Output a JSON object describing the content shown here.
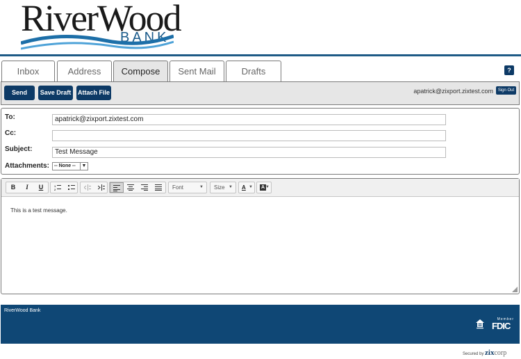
{
  "brand": {
    "logo_name": "RiverWood",
    "logo_sub": "BANK",
    "wave_colors": [
      "#1d6fa8",
      "#4fa3d8"
    ]
  },
  "tabs": [
    {
      "label": "Inbox",
      "active": false
    },
    {
      "label": "Address",
      "active": false
    },
    {
      "label": "Compose",
      "active": true
    },
    {
      "label": "Sent Mail",
      "active": false
    },
    {
      "label": "Drafts",
      "active": false
    }
  ],
  "help": {
    "label": "?"
  },
  "toolbar": {
    "send_label": "Send",
    "save_draft_label": "Save Draft",
    "attach_label": "Attach File",
    "user_email": "apatrick@zixport.zixtest.com",
    "signout_label": "Sign Out"
  },
  "form": {
    "to_label": "To:",
    "to_value": "apatrick@zixport.zixtest.com",
    "cc_label": "Cc:",
    "cc_value": "",
    "subject_label": "Subject:",
    "subject_value": "Test Message",
    "attachments_label": "Attachments:",
    "attachments_value": "-- None --"
  },
  "editor": {
    "font_label": "Font",
    "size_label": "Size",
    "text_color_glyph": "A",
    "bg_color_glyph": "A",
    "body": "This is a test message.",
    "toolbar_icons": [
      "bold-icon",
      "italic-icon",
      "underline-icon",
      "ordered-list-icon",
      "unordered-list-icon",
      "outdent-icon",
      "indent-icon",
      "align-left-icon",
      "align-center-icon",
      "align-right-icon",
      "justify-icon"
    ]
  },
  "footer": {
    "bank_name": "RiverWood Bank",
    "fdic_member": "Member",
    "fdic_text": "FDIC",
    "secured_by": "Secured by",
    "zix_brand": "zix",
    "corp_brand": "corp"
  },
  "colors": {
    "primary": "#0d3a66",
    "footer": "#0f4775",
    "rule": "#1d5a86"
  }
}
